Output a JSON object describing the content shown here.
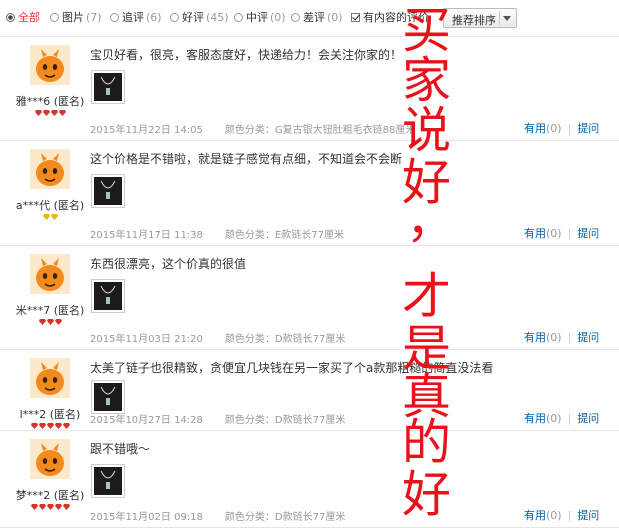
{
  "filters": [
    {
      "label": "全部",
      "count": "",
      "active": true
    },
    {
      "label": "图片",
      "count": "(7)",
      "active": false
    },
    {
      "label": "追评",
      "count": "(6)",
      "active": false
    },
    {
      "label": "好评",
      "count": "(45)",
      "active": false
    },
    {
      "label": "中评",
      "count": "(0)",
      "active": false
    },
    {
      "label": "差评",
      "count": "(0)",
      "active": false
    }
  ],
  "content_only_checkbox": {
    "label": "有内容的评价",
    "checked": true
  },
  "sort_button": {
    "label": "推荐排序"
  },
  "actions": {
    "useful": "有用",
    "useful_count": "(0)",
    "ask": "提问"
  },
  "spec_prefix": "颜色分类：",
  "anonymous_suffix": "(匿名)",
  "comments": [
    {
      "user": "雅***6",
      "text": "宝贝好看，很亮，客服态度好，快递给力！会关注你家的！",
      "date": "2015年11月22日 14:05",
      "spec": "G复古银大钮肚粗毛衣链88厘米",
      "level_icons": 4,
      "level_color": "#d8342a"
    },
    {
      "user": "a***代",
      "text": "这个价格是不错啦，就是链子感觉有点细，不知道会不会断",
      "date": "2015年11月17日 11:38",
      "spec": "E款链长77厘米",
      "level_icons": 2,
      "level_color": "#e6b800"
    },
    {
      "user": "米***7",
      "text": "东西很漂亮，这个价真的很值",
      "date": "2015年11月03日 21:20",
      "spec": "D款链长77厘米",
      "level_icons": 3,
      "level_color": "#d8342a"
    },
    {
      "user": "l***2",
      "text": "太美了链子也很精致，贪便宜几块钱在另一家买了个a款那粗糙的简直没法看",
      "date": "2015年10月27日 14:28",
      "spec": "D款链长77厘米",
      "level_icons": 5,
      "level_color": "#d8342a"
    },
    {
      "user": "梦***2",
      "text": "跟不错哦～",
      "date": "2015年11月02日 09:18",
      "spec": "D款链长77厘米",
      "level_icons": 5,
      "level_color": "#d8342a"
    }
  ],
  "overlay_text": [
    "买",
    "家",
    "说",
    "好",
    "，",
    "才",
    "是",
    "真",
    "的",
    "好"
  ],
  "colors": {
    "overlay": "#e8121a",
    "link": "#005ea7",
    "muted": "#999999",
    "avatar": "#f28a1e"
  }
}
